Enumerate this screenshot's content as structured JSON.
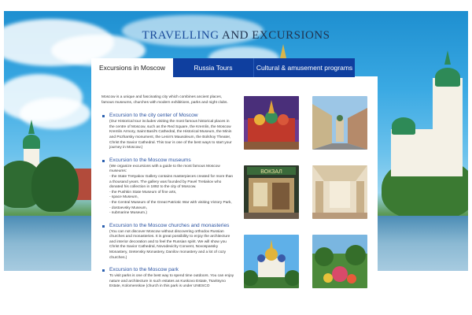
{
  "header": {
    "title_part1": "TRAVELLING",
    "title_part2": "AND EXCURSIONS"
  },
  "tabs": [
    {
      "label": "Excursions in Moscow",
      "active": true
    },
    {
      "label": "Russia Tours",
      "active": false
    },
    {
      "label": "Cultural & amusement programs",
      "active": false
    }
  ],
  "intro": "Moscow is a unique and fascinating city which combines ancient places, famous museums, churches with modern exhibitions, parks and night clubs.",
  "sections": [
    {
      "title": "Excursion to the city center of Moscow",
      "body": "(Our Historical tour includes visiting the most famous historical places in the centre of Moscow, such as the Red Square, the Kremlin, the Moscow Kremlin Armory, Saint Basil's Cathedral, the Historical Museum, the Minin and Pozharsky monument, the Lenin's Mausoleum, the Bolshoy Theater, Christ the Savior Cathedral. This tour is one of the best ways to start your journey in Moscow.)"
    },
    {
      "title": "Excursion to the Moscow museums",
      "body": "(We organize excursions with a guide to the most famous Moscow museums:",
      "items": [
        "- the State Tretyakov Gallery contains masterpieces created for more than a thousand years. The gallery was founded by Pavel Tretiakov who donated his collection in 1892 to the city of Moscow.",
        "- the Pushkin State Museum of fine arts,",
        "- space Museum,",
        "- the Central Museum of the Great Patriotic War with visiting Victory Park,",
        "- dostoevsky Museum,",
        "- submarine Museum.)"
      ]
    },
    {
      "title": "Excursion to the Moscow churches and monasteries",
      "body": "(You can not discover Moscow without discovering orthodox Russian churches and monasteries. It is great possibility to enjoy the architecture and interior decoration and to feel the Russian spirit. We will show you Christ the Savior Cathedral, Novodevichy Convent, Novospassky Monastery, Sretensky Monastery, Danilov monastery and a lot of cozy churches.)"
    },
    {
      "title": "Excursion to the Moscow park",
      "body": "To visit parks is one of the best way to spend time outdoors. You can enjoy nature and architecture in such estates as Kuskovo Estate, Tsaritsyno Estate, Kolomenskoe (church in this park is under UNESCO"
    }
  ],
  "photos": [
    {
      "name": "red-square-photo"
    },
    {
      "name": "moscow-street-photo"
    },
    {
      "name": "vokzal-museum-photo",
      "sign": "ВОКЗАЛ"
    },
    {
      "name": "gallery-hall-photo"
    },
    {
      "name": "monastery-photo"
    },
    {
      "name": "park-photo"
    }
  ],
  "colors": {
    "tab_bg": "#0f3f9f",
    "heading": "#2a52a0",
    "title_blue": "#1b4c9b"
  }
}
